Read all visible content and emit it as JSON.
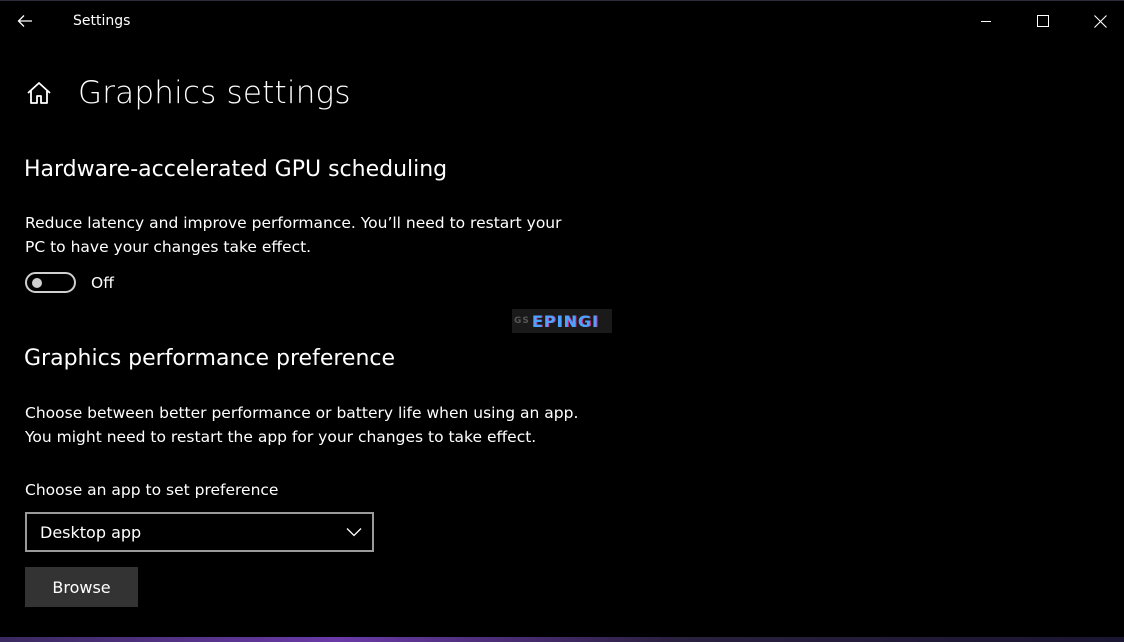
{
  "window": {
    "app_title": "Settings"
  },
  "header": {
    "title": "Graphics settings"
  },
  "gpu_scheduling": {
    "heading": "Hardware-accelerated GPU scheduling",
    "description_line1": "Reduce latency and improve performance. You’ll need to restart your",
    "description_line2": "PC to have your changes take effect.",
    "toggle_state": "Off",
    "toggle_on": false
  },
  "watermark": {
    "prefix": "GS",
    "text": "EPINGI"
  },
  "performance_preference": {
    "heading": "Graphics performance preference",
    "description_line1": "Choose between better performance or battery life when using an app.",
    "description_line2": "You might need to restart the app for your changes to take effect.",
    "choose_label": "Choose an app to set preference",
    "selected_app_type": "Desktop app",
    "browse_label": "Browse"
  },
  "icons": {
    "back": "back-arrow-icon",
    "home": "home-icon",
    "minimize": "minimize-icon",
    "maximize": "maximize-icon",
    "close": "close-icon",
    "chevron": "chevron-down-icon"
  },
  "colors": {
    "background": "#000000",
    "text": "#ffffff",
    "button_bg": "#333333",
    "dropdown_border": "#9a9a9a"
  }
}
